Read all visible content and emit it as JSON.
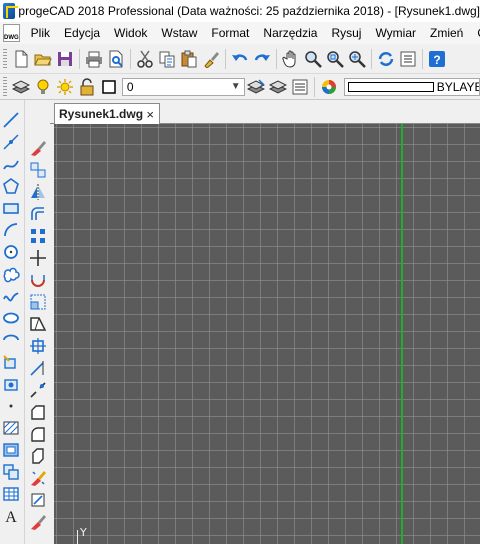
{
  "title": {
    "text": "progeCAD 2018 Professional  (Data ważności: 25 października 2018) - [Rysunek1.dwg]"
  },
  "menu": [
    "Plik",
    "Edycja",
    "Widok",
    "Wstaw",
    "Format",
    "Narzędzia",
    "Rysuj",
    "Wymiar",
    "Zmień",
    "Ob"
  ],
  "dwg_badge": "DWG",
  "layer": {
    "current": "0"
  },
  "color": {
    "current": "BYLAYER"
  },
  "tab": {
    "name": "Rysunek1.dwg",
    "close": "×"
  },
  "ucs": {
    "label": "Y"
  },
  "colors": {
    "canvas": "#5b5b5b",
    "grid": "#9696a0",
    "y_axis": "#1fae2a",
    "accent_blue": "#1e6fd1"
  }
}
